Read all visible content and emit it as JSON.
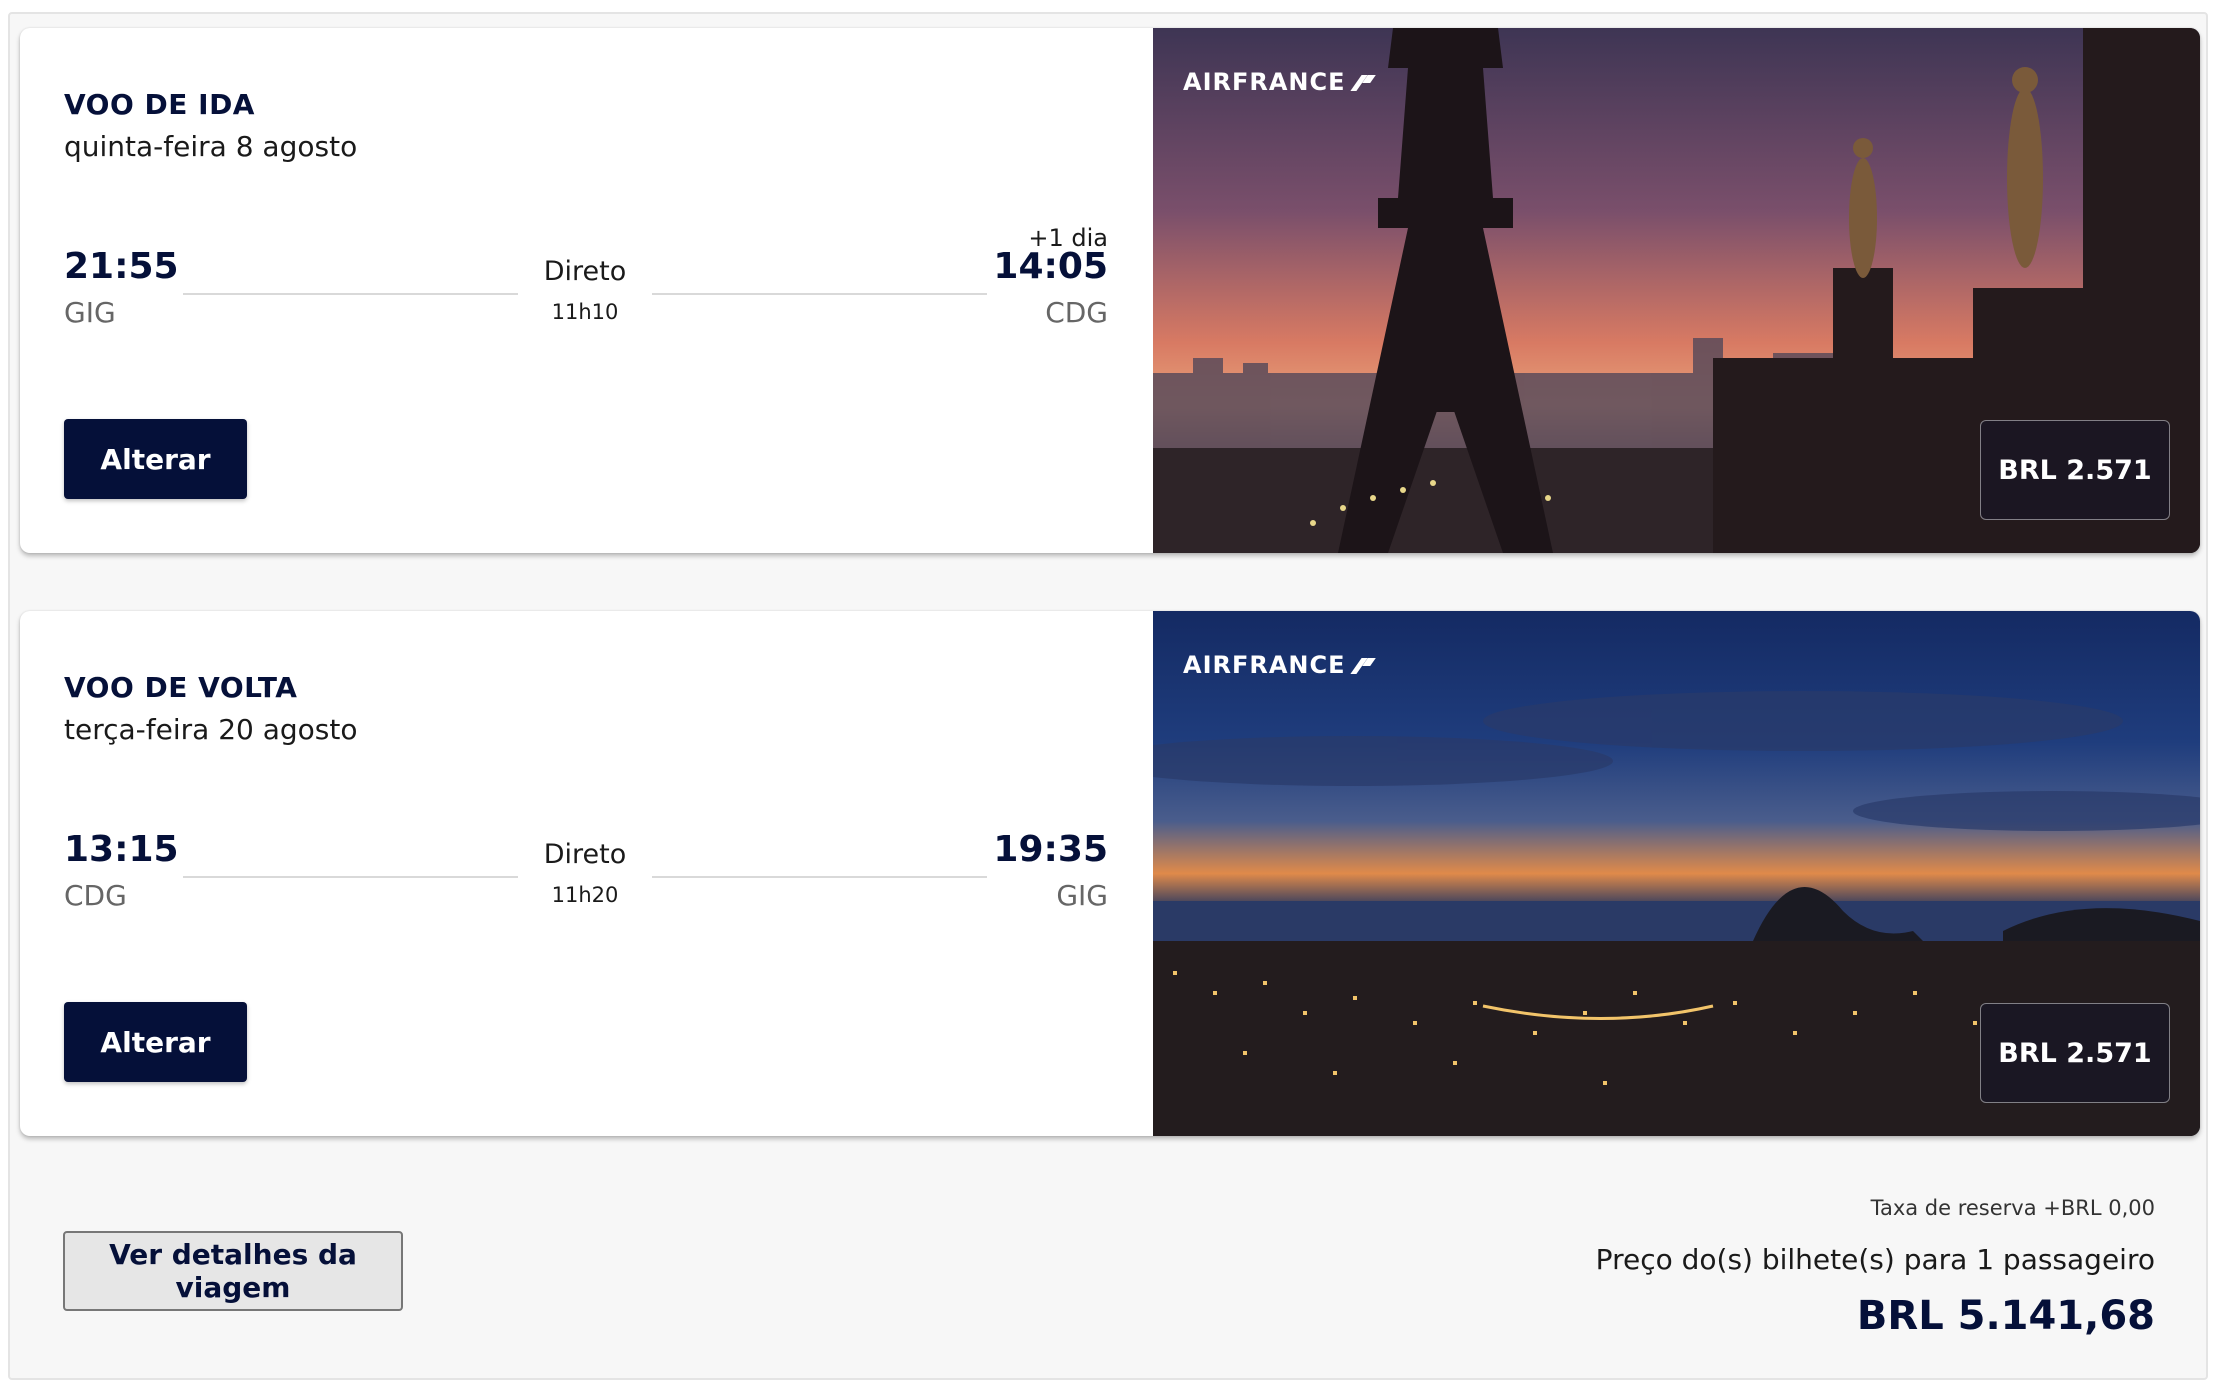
{
  "outbound": {
    "title": "VOO DE IDA",
    "date": "quinta-feira 8 agosto",
    "departure_time": "21:55",
    "departure_airport": "GIG",
    "arrival_day_offset": "+1 dia",
    "arrival_time": "14:05",
    "arrival_airport": "CDG",
    "stops": "Direto",
    "duration": "11h10",
    "change_label": "Alterar",
    "brand": "AIRFRANCE",
    "price": "BRL 2.571"
  },
  "inbound": {
    "title": "VOO DE VOLTA",
    "date": "terça-feira 20 agosto",
    "departure_time": "13:15",
    "departure_airport": "CDG",
    "arrival_time": "19:35",
    "arrival_airport": "GIG",
    "stops": "Direto",
    "duration": "11h20",
    "change_label": "Alterar",
    "brand": "AIRFRANCE",
    "price": "BRL 2.571"
  },
  "footer": {
    "details_button": "Ver detalhes da viagem",
    "booking_fee": "Taxa de reserva +BRL 0,00",
    "price_label": "Preço do(s) bilhete(s) para 1 passageiro",
    "total_price": "BRL 5.141,68"
  },
  "colors": {
    "primary": "#051039",
    "button_secondary_bg": "#e6e6e6"
  },
  "icons": {
    "brand_logo": "airfrance-logo"
  }
}
